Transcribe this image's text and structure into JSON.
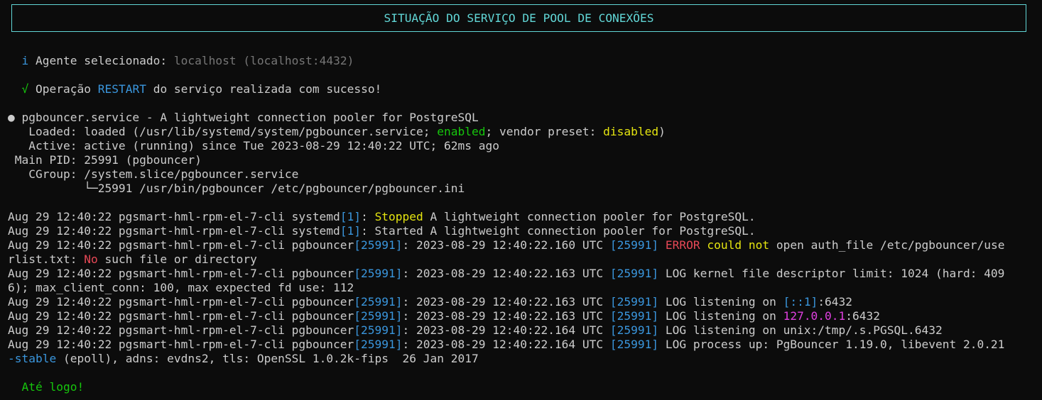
{
  "title": "SITUAÇÃO DO SERVIÇO DE POOL DE CONEXÕES",
  "agent": {
    "icon": "i",
    "label": "Agente selecionado: ",
    "value": "localhost (localhost:4432)"
  },
  "operation": {
    "icon": "√",
    "prefix": "Operação ",
    "action": "RESTART",
    "suffix": " do serviço realizada com sucesso!"
  },
  "status": {
    "bullet": "●",
    "header": " pgbouncer.service - A lightweight connection pooler for PostgreSQL",
    "loaded_prefix": "   Loaded: loaded (/usr/lib/systemd/system/pgbouncer.service; ",
    "loaded_enabled": "enabled",
    "loaded_mid": "; vendor preset: ",
    "loaded_disabled": "disabled",
    "loaded_suffix": ")",
    "active": "   Active: active (running) since Tue 2023-08-29 12:40:22 UTC; 62ms ago",
    "main_pid": " Main PID: 25991 (pgbouncer)",
    "cgroup": "   CGroup: /system.slice/pgbouncer.service",
    "cgroup_child": "           └─25991 /usr/bin/pgbouncer /etc/pgbouncer/pgbouncer.ini"
  },
  "log": {
    "prefix": "Aug 29 12:40:22 pgsmart-hml-rpm-el-7-cli ",
    "systemd": "systemd",
    "systemd_pid": "[1]",
    "pgb": "pgbouncer",
    "pgb_pid": "[25991]",
    "stopped": "Stopped",
    "line1_rest": " A lightweight connection pooler for PostgreSQL.",
    "line2_rest": ": Started A lightweight connection pooler for PostgreSQL.",
    "ts160": ": 2023-08-29 12:40:22.160 UTC ",
    "ts163": ": 2023-08-29 12:40:22.163 UTC ",
    "ts164": ": 2023-08-29 12:40:22.164 UTC ",
    "pid_bracket": "[25991]",
    "error": "ERROR",
    "could": "could",
    "not": "not",
    "error_rest": " open auth_file /etc/pgbouncer/use",
    "error_wrap_a": "rlist.txt: ",
    "error_no": "No",
    "error_wrap_b": " such file or directory",
    "log_kernel": " LOG kernel file descriptor limit: 1024 (hard: 409",
    "log_kernel_wrap": "6); max_client_conn: 100, max expected fd use: 112",
    "log_listen": " LOG listening on ",
    "ipv6": "[::1]",
    "ipv4": "127.0.0.1",
    "port": ":6432",
    "log_unix": " LOG listening on unix:/tmp/.s.PGSQL.6432",
    "log_up": " LOG process up: PgBouncer 1.19.0, libevent 2.0.21",
    "log_up_wrap_a": "-stable",
    "log_up_wrap_b": " (epoll), adns: evdns2, tls: OpenSSL 1.0.2k-fips  26 Jan 2017"
  },
  "farewell": "Até logo!",
  "colors": {
    "background": "#0c0c0c",
    "text": "#cccccc",
    "cyan": "#3a96dd",
    "green": "#16c60c",
    "yellow": "#f9f1a5",
    "red": "#e74856",
    "magenta": "#d670d6"
  }
}
